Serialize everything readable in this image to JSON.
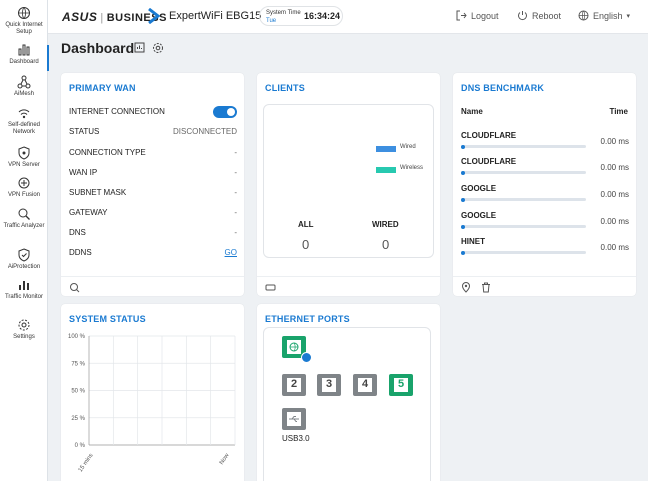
{
  "sidebar": {
    "items": [
      {
        "label": "Quick Internet Setup",
        "icon": "globe-setup-icon"
      },
      {
        "label": "Dashboard",
        "icon": "bar-chart-icon",
        "active": true
      },
      {
        "label": "AiMesh",
        "icon": "mesh-icon"
      },
      {
        "label": "Self-defined Network",
        "icon": "network-icon"
      },
      {
        "label": "VPN Server",
        "icon": "vpn-server-icon"
      },
      {
        "label": "VPN Fusion",
        "icon": "vpn-fusion-icon"
      },
      {
        "label": "Traffic Analyzer",
        "icon": "traffic-analyzer-icon"
      },
      {
        "label": "AiProtection",
        "icon": "shield-icon"
      },
      {
        "label": "Traffic Monitor",
        "icon": "traffic-monitor-icon"
      },
      {
        "label": "Settings",
        "icon": "gear-icon"
      }
    ]
  },
  "topbar": {
    "brand": "ASUS",
    "brand_sub": "BUSINESS",
    "model": "ExpertWiFi EBG15",
    "system_time_label": "System Time",
    "system_day": "Tue",
    "system_time": "16:34:24",
    "logout": "Logout",
    "reboot": "Reboot",
    "language": "English"
  },
  "header": {
    "title": "Dashboard"
  },
  "primary_wan": {
    "title": "PRIMARY WAN",
    "rows": [
      {
        "key": "INTERNET CONNECTION",
        "value": ""
      },
      {
        "key": "STATUS",
        "value": "DISCONNECTED"
      },
      {
        "key": "CONNECTION TYPE",
        "value": "-"
      },
      {
        "key": "WAN IP",
        "value": "-"
      },
      {
        "key": "SUBNET MASK",
        "value": "-"
      },
      {
        "key": "GATEWAY",
        "value": "-"
      },
      {
        "key": "DNS",
        "value": "-"
      },
      {
        "key": "DDNS",
        "value": "GO"
      }
    ],
    "internet_connection_enabled": true
  },
  "clients": {
    "title": "CLIENTS",
    "legend": [
      {
        "name": "Wired",
        "color": "#3d8fe0"
      },
      {
        "name": "Wireless",
        "color": "#27c9b0"
      }
    ],
    "all_label": "ALL",
    "all_value": "0",
    "wired_label": "WIRED",
    "wired_value": "0"
  },
  "dns_benchmark": {
    "title": "DNS BENCHMARK",
    "col_name": "Name",
    "col_time": "Time",
    "rows": [
      {
        "name": "CLOUDFLARE",
        "time": "0.00 ms"
      },
      {
        "name": "CLOUDFLARE",
        "time": "0.00 ms"
      },
      {
        "name": "GOOGLE",
        "time": "0.00 ms"
      },
      {
        "name": "GOOGLE",
        "time": "0.00 ms"
      },
      {
        "name": "HINET",
        "time": "0.00 ms"
      }
    ]
  },
  "system_status": {
    "title": "SYSTEM STATUS"
  },
  "chart_data": {
    "type": "line",
    "title": "",
    "y_ticks": [
      "100 %",
      "75 %",
      "50 %",
      "25 %",
      "0 %"
    ],
    "x_ticks": [
      "15 mins",
      "Now"
    ],
    "ylim": [
      0,
      100
    ],
    "grid": true,
    "series": []
  },
  "ethernet_ports": {
    "title": "ETHERNET PORTS",
    "wan_port": {
      "active": true,
      "color": "#19a36b"
    },
    "lan_ports": [
      {
        "label": "2",
        "active": false
      },
      {
        "label": "3",
        "active": false
      },
      {
        "label": "4",
        "active": false
      },
      {
        "label": "5",
        "active": true
      }
    ],
    "usb_label": "USB3.0"
  }
}
